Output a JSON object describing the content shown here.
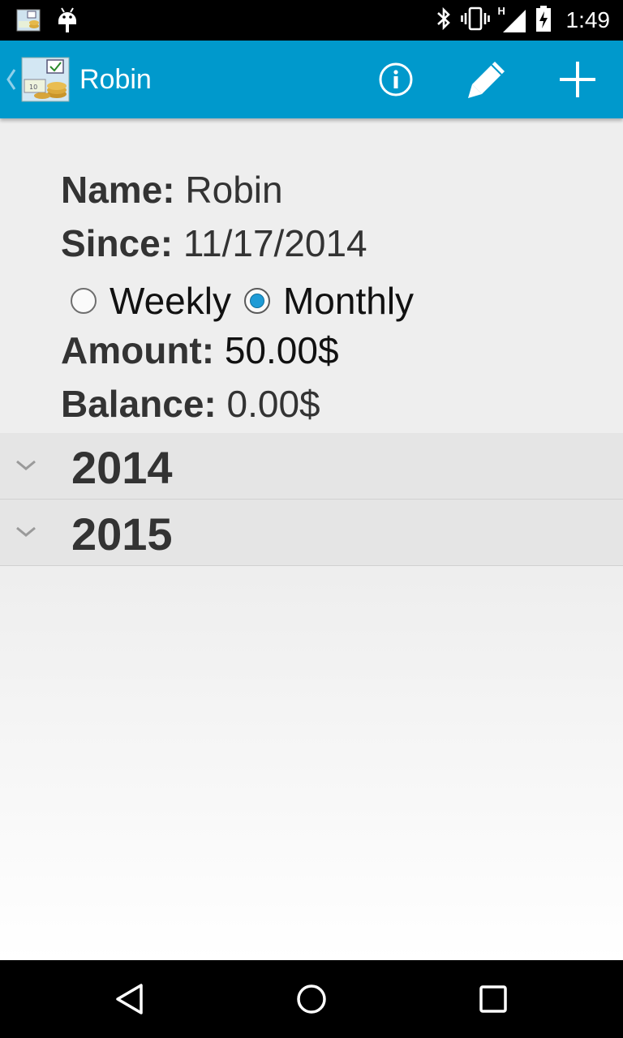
{
  "status_bar": {
    "time": "1:49",
    "network_label": "H",
    "icons": [
      "app-notification-icon",
      "android-debug-icon",
      "bluetooth-icon",
      "vibrate-icon",
      "signal-icon",
      "battery-charging-icon"
    ]
  },
  "action_bar": {
    "title": "Robin",
    "icons": [
      "up-chevron-icon",
      "app-icon",
      "info-icon",
      "pencil-icon",
      "plus-icon"
    ],
    "accent": "#0099cc"
  },
  "details": {
    "name_label": "Name:",
    "name_value": "Robin",
    "since_label": "Since:",
    "since_value": "11/17/2014",
    "frequency": {
      "options": [
        {
          "label": "Weekly",
          "checked": false
        },
        {
          "label": "Monthly",
          "checked": true
        }
      ]
    },
    "amount_label": "Amount:",
    "amount_value": "50.00$",
    "balance_label": "Balance:",
    "balance_value": "0.00$"
  },
  "groups": [
    {
      "title": "2014",
      "expanded": false
    },
    {
      "title": "2015",
      "expanded": false
    }
  ],
  "nav_bar": {
    "icons": [
      "back-icon",
      "home-icon",
      "recent-apps-icon"
    ]
  }
}
